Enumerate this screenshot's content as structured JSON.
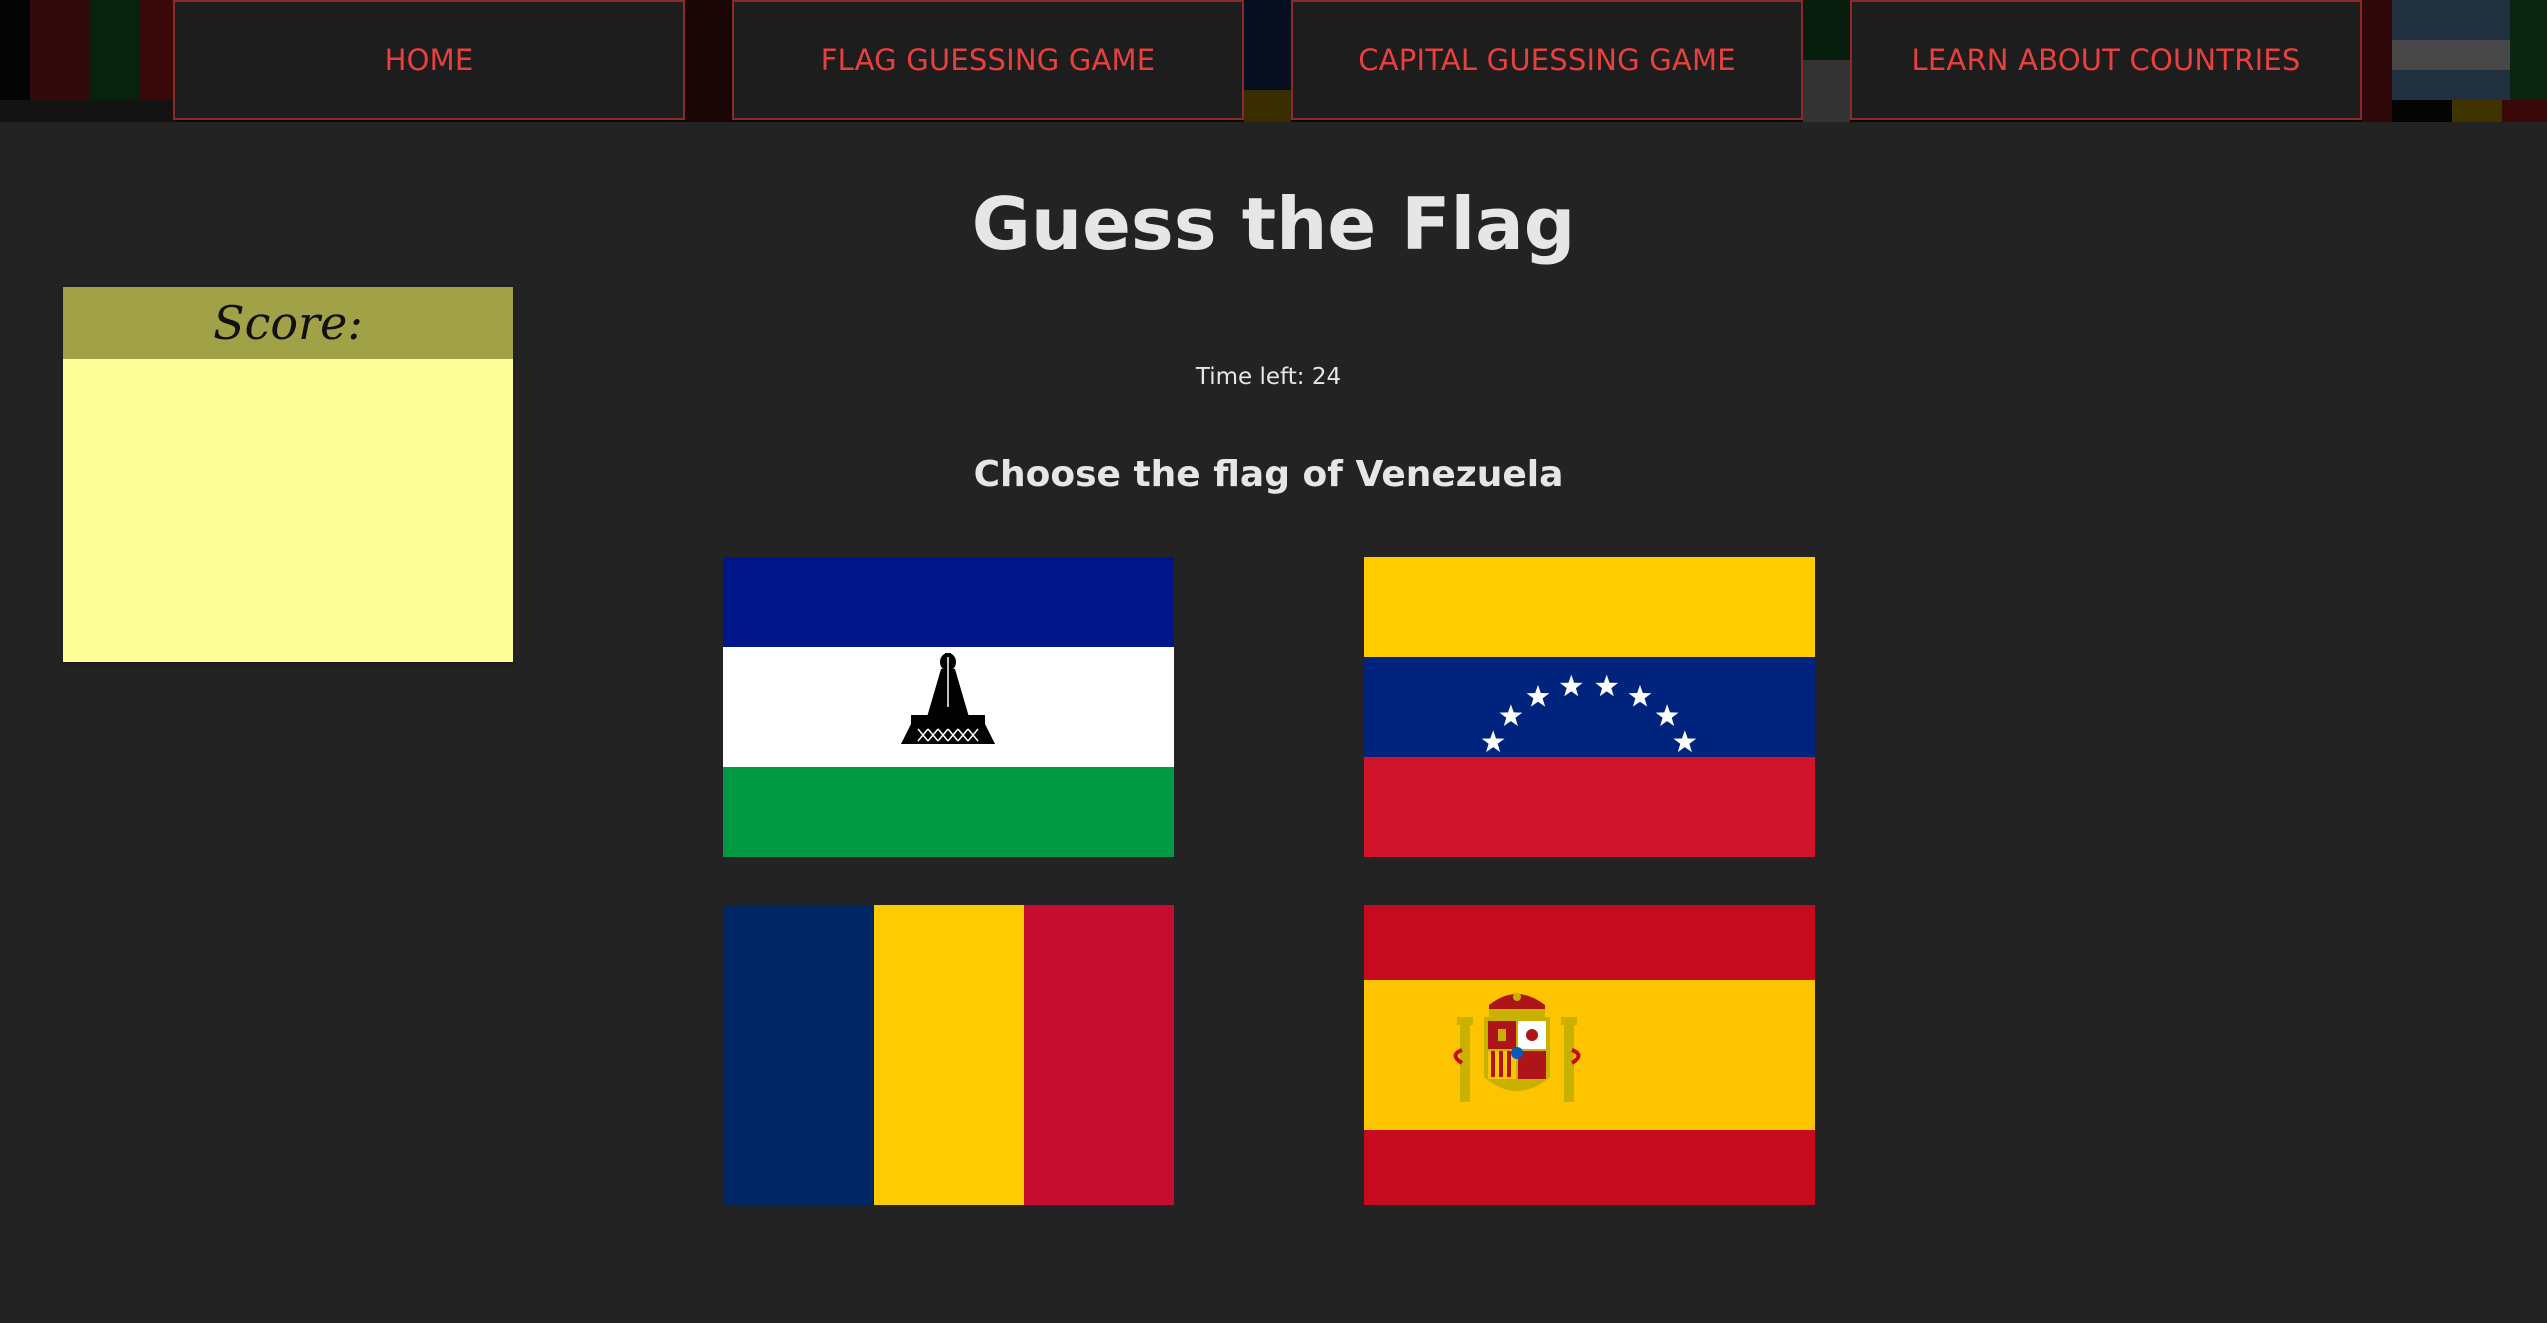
{
  "nav": {
    "items": [
      {
        "label": "HOME"
      },
      {
        "label": "FLAG GUESSING GAME"
      },
      {
        "label": "CAPITAL GUESSING GAME"
      },
      {
        "label": "LEARN ABOUT COUNTRIES"
      }
    ]
  },
  "game": {
    "title": "Guess the Flag",
    "timer_text": "Time left: 24",
    "prompt": "Choose the flag of Venezuela"
  },
  "score": {
    "label": "Score:"
  },
  "options": [
    {
      "icon": "lesotho-flag"
    },
    {
      "icon": "venezuela-flag"
    },
    {
      "icon": "chad-flag"
    },
    {
      "icon": "spain-flag"
    }
  ],
  "colors": {
    "background": "#232323",
    "nav_text": "#e8403e",
    "nav_border": "#8a2a2a",
    "score_header": "#a1a147",
    "score_body": "#ffff99"
  }
}
